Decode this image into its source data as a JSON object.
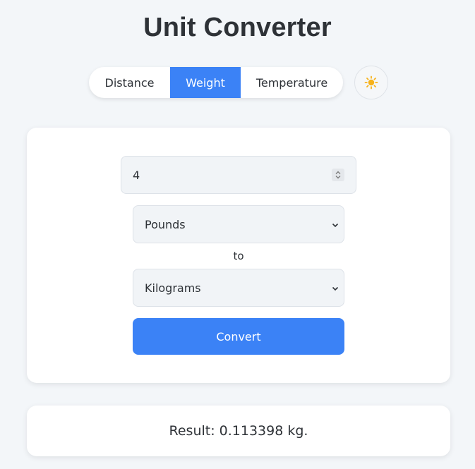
{
  "header": {
    "title": "Unit Converter"
  },
  "tabs": [
    {
      "label": "Distance",
      "active": false
    },
    {
      "label": "Weight",
      "active": true
    },
    {
      "label": "Temperature",
      "active": false
    }
  ],
  "theme_toggle": {
    "icon": "sun-icon"
  },
  "form": {
    "value": "4",
    "from_unit": "Pounds",
    "to_label": "to",
    "to_unit": "Kilograms",
    "convert_label": "Convert"
  },
  "result": {
    "text": "Result: 0.113398 kg."
  },
  "colors": {
    "accent": "#3b82f6",
    "background": "#f3f6f9",
    "card": "#ffffff"
  }
}
